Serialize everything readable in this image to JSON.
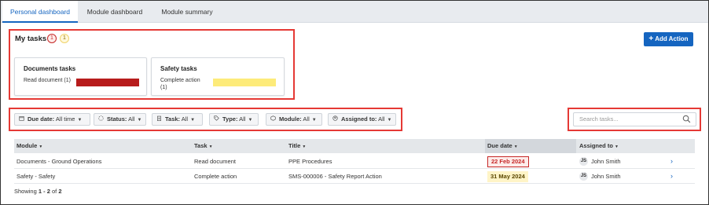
{
  "tabs": [
    {
      "label": "Personal dashboard",
      "active": true
    },
    {
      "label": "Module dashboard",
      "active": false
    },
    {
      "label": "Module summary",
      "active": false
    }
  ],
  "my_tasks": {
    "title": "My tasks",
    "badge_red": "1",
    "badge_yellow": "1",
    "cards": [
      {
        "title": "Documents tasks",
        "subtitle": "Read document (1)",
        "bar_color": "#b71c1c"
      },
      {
        "title": "Safety tasks",
        "subtitle": "Complete action (1)",
        "bar_color": "#fdeb7a"
      }
    ]
  },
  "add_action": {
    "icon": "plus-icon",
    "label": "Add Action"
  },
  "filters": [
    {
      "icon": "calendar-icon",
      "key": "Due date:",
      "value": "All time"
    },
    {
      "icon": "status-icon",
      "key": "Status:",
      "value": "All"
    },
    {
      "icon": "clipboard-icon",
      "key": "Task:",
      "value": "All"
    },
    {
      "icon": "tag-icon",
      "key": "Type:",
      "value": "All"
    },
    {
      "icon": "module-icon",
      "key": "Module:",
      "value": "All"
    },
    {
      "icon": "user-circle-icon",
      "key": "Assigned to:",
      "value": "All"
    }
  ],
  "search": {
    "placeholder": "Search tasks..."
  },
  "table": {
    "columns": [
      "Module",
      "Task",
      "Title",
      "Due date",
      "Assigned to"
    ],
    "rows": [
      {
        "module": "Documents - Ground Operations",
        "task": "Read document",
        "title": "PPE Procedures",
        "due": "22 Feb 2024",
        "due_status": "overdue",
        "initials": "JS",
        "assignee": "John Smith"
      },
      {
        "module": "Safety - Safety",
        "task": "Complete action",
        "title": "SMS-000006 - Safety Report Action",
        "due": "31 May 2024",
        "due_status": "upcoming",
        "initials": "JS",
        "assignee": "John Smith"
      }
    ]
  },
  "footer": {
    "prefix": "Showing ",
    "range": "1 - 2",
    "of": " of ",
    "total": "2"
  },
  "colors": {
    "accent": "#1565c0",
    "highlight_border": "#e53935",
    "overdue": "#c62828",
    "upcoming": "#fff4c7"
  }
}
